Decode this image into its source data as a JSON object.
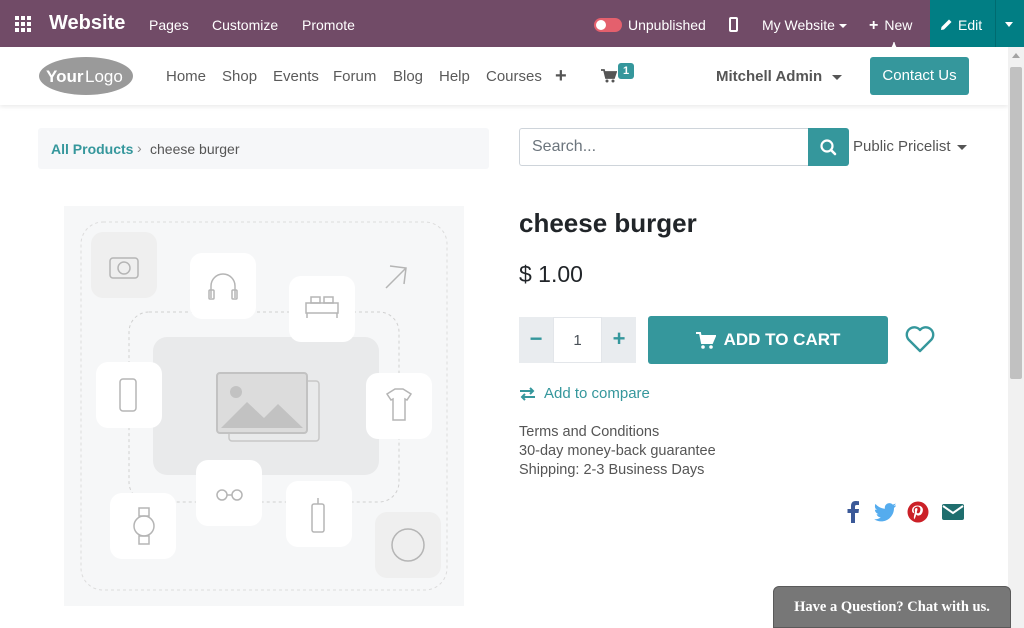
{
  "adminbar": {
    "brand": "Website",
    "menu": [
      "Pages",
      "Customize",
      "Promote"
    ],
    "publish_status": "Unpublished",
    "website": "My Website",
    "new_label": "New",
    "edit_label": "Edit"
  },
  "navbar": {
    "logo_text": "YourLogo",
    "items": [
      "Home",
      "Shop",
      "Events",
      "Forum",
      "Blog",
      "Help",
      "Courses"
    ],
    "cart_count": "1",
    "user": "Mitchell Admin",
    "contact_label": "Contact Us"
  },
  "breadcrumb": {
    "link": "All Products",
    "separator": "›",
    "current": "cheese burger"
  },
  "search": {
    "placeholder": "Search...",
    "pricelist": "Public Pricelist"
  },
  "product": {
    "name": "cheese burger",
    "price": "$ 1.00",
    "quantity": "1",
    "add_to_cart": "ADD TO CART",
    "compare": "Add to compare",
    "terms": [
      "Terms and Conditions",
      "30-day money-back guarantee",
      "Shipping: 2-3 Business Days"
    ]
  },
  "chat": {
    "label": "Have a Question? Chat with us."
  },
  "colors": {
    "admin_bar": "#714B67",
    "edit": "#017E84",
    "primary": "#35979c",
    "facebook": "#3b5998",
    "twitter": "#55acee",
    "pinterest": "#cb2027",
    "email": "#1f6e6e"
  }
}
